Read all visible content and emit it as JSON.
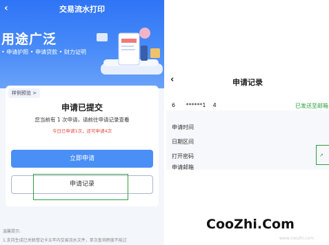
{
  "left": {
    "nav_back": "‹",
    "nav_title": "交易流水打印",
    "hero_title": "用途广泛",
    "hero_tags": "• 申请护照  • 申请贷款  • 财力证明",
    "sample_tag": "样例预览 >",
    "card_title": "申请已提交",
    "card_desc": "您当前有 1 次申请，请前往申请记录查看",
    "card_note": "今日已申请1次，还可申请4次",
    "apply_button": "立即申请",
    "records_button": "申请记录",
    "tips_head": "温馨提示:",
    "tips_line": "1.支持生成已关联借记卡五年内交易流水文件，单次查询跨度不能过"
  },
  "right": {
    "back": "‹",
    "title": "申请记录",
    "card_number": "6      ******1    4",
    "status": "已发送至邮箱",
    "rows": [
      "申请时间",
      "日期区间",
      "打开密码",
      "申请邮箱"
    ]
  },
  "watermark": "CooZhi.Com",
  "watermark_faint": "www.coozhi.com"
}
